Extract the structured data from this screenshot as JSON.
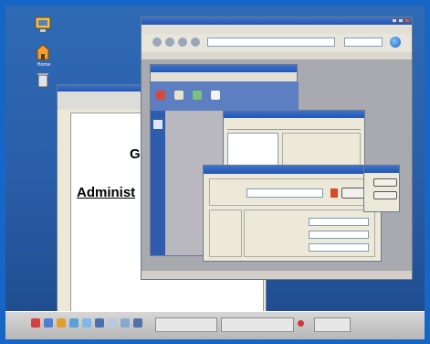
{
  "desktop": {
    "icons": [
      {
        "name": "computer-icon",
        "label": ""
      },
      {
        "name": "home-icon",
        "label": "Home"
      },
      {
        "name": "trash-icon",
        "label": ""
      }
    ]
  },
  "doc_window": {
    "heading": "GO-",
    "subheading": "Administ"
  },
  "browser": {
    "title": "",
    "url": "",
    "search": ""
  },
  "control_panel": {
    "title": ""
  },
  "properties": {
    "title": ""
  },
  "front_dialog": {
    "title": "",
    "name_label": "",
    "name_value": ""
  },
  "colors": {
    "frame_border": "#1566c7",
    "desktop": "#2a5ea8",
    "titlebar": "#2055b5",
    "window_bg": "#ece9d8"
  }
}
